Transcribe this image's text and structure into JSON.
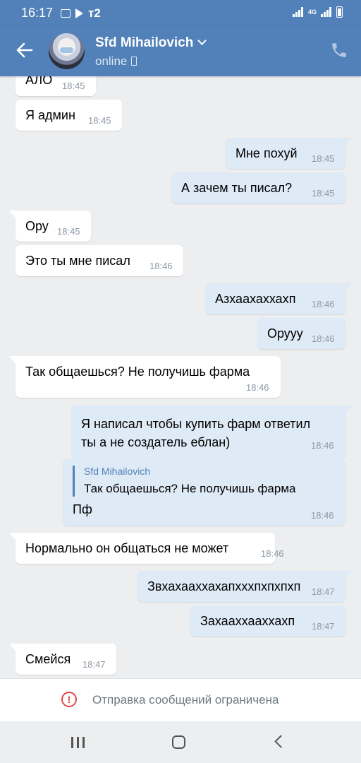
{
  "status_bar": {
    "time": "16:17",
    "carrier": "т2",
    "network": "4G"
  },
  "header": {
    "name": "Sfd Mihailovich",
    "status": "online"
  },
  "messages": [
    {
      "dir": "in",
      "text": "АЛО",
      "time": "18:45"
    },
    {
      "dir": "in",
      "text": "Я админ",
      "time": "18:45"
    },
    {
      "dir": "out",
      "text": "Мне похуй",
      "time": "18:45"
    },
    {
      "dir": "out",
      "text": "А зачем ты писал?",
      "time": "18:45"
    },
    {
      "dir": "in",
      "text": "Ору",
      "time": "18:45"
    },
    {
      "dir": "in",
      "text": "Это ты мне писал",
      "time": "18:46"
    },
    {
      "dir": "out",
      "text": "Азхаахаххахп",
      "time": "18:46"
    },
    {
      "dir": "out",
      "text": "Оруyy",
      "time": "18:46"
    },
    {
      "dir": "in",
      "text": "Так общаешься? Не получишь фарма",
      "time": "18:46"
    },
    {
      "dir": "out",
      "text": "Я написал чтобы купить фарм ответил\nты а не создатель еблан)",
      "time": "18:46"
    },
    {
      "dir": "out",
      "reply_name": "Sfd Mihailovich",
      "reply_text": "Так общаешься? Не получишь фарма",
      "text": "Пф",
      "time": "18:46"
    },
    {
      "dir": "in",
      "text": "Нормально он общаться не может",
      "time": "18:46"
    },
    {
      "dir": "out",
      "text": "Звхахааххахапхххпхпхпхп",
      "time": "18:47"
    },
    {
      "dir": "out",
      "text": "Захааххааххахп",
      "time": "18:47"
    },
    {
      "dir": "in",
      "text": "Смейся",
      "time": "18:47"
    }
  ],
  "notice": {
    "text": "Отправка сообщений ограничена",
    "icon": "alert-circle-icon"
  },
  "colors": {
    "accent": "#5181b8",
    "outgoing": "#dfeaf7",
    "incoming": "#ffffff",
    "background": "#edeef0",
    "alert": "#e64646"
  }
}
